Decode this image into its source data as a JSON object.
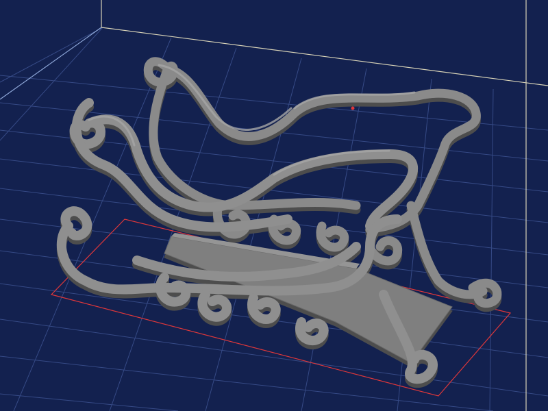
{
  "viewport": {
    "background_color": "#13214f",
    "grid_color": "#3a4f8c",
    "build_volume_edge_color": "#d9d4b8",
    "build_volume_left_edge_color": "#8ea7d8",
    "footprint_color": "#e0373a",
    "model_color": "#8a8a8a",
    "model_shadow_color": "#555555",
    "model_highlight_color": "#a4a4a4",
    "model_name": "sleigh-model",
    "grid": true
  }
}
